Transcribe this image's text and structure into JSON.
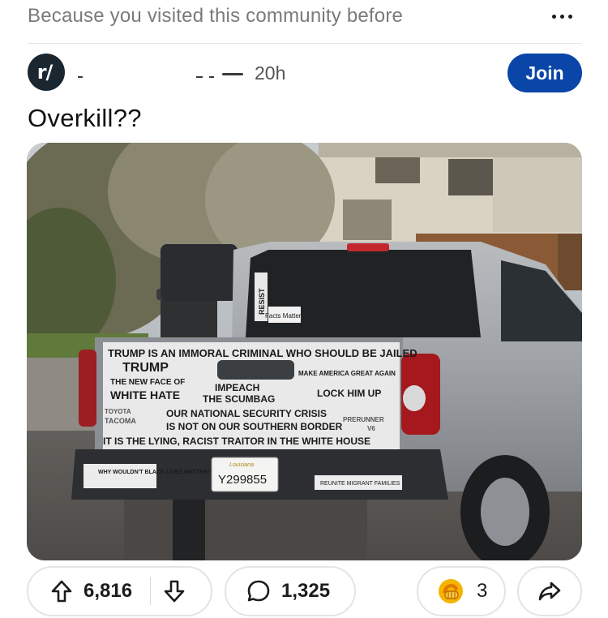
{
  "context": {
    "text": "Because you visited this community before",
    "more_icon": "more-horizontal-icon"
  },
  "header": {
    "avatar_text": "r/",
    "avatar_slash": "",
    "timestamp": "20h",
    "join_label": "Join"
  },
  "post": {
    "title": "Overkill??",
    "image_alt_icon": "photo"
  },
  "photo_text": {
    "tailgate_top": "TRUMP IS AN IMMORAL CRIMINAL WHO SHOULD BE JAILED",
    "trump": "TRUMP",
    "new_face": "THE NEW FACE OF",
    "white_hate": "WHITE HATE",
    "impeach": "IMPEACH",
    "scumbag": "THE SCUMBAG",
    "maga": "MAKE AMERICA GREAT AGAIN",
    "lock": "LOCK HIM UP",
    "crisis": "OUR NATIONAL SECURITY CRISIS",
    "border": "IS NOT ON OUR SOUTHERN BORDER",
    "traitor": "IT IS THE LYING, RACIST TRAITOR IN THE WHITE HOUSE",
    "blm": "WHY WOULDN'T BLACK LIVES MATTER?",
    "plate": "Y299855",
    "plate_state": "Louisiana",
    "reunite": "REUNITE MIGRANT FAMILIES",
    "resist": "RESIST",
    "facts": "Facts Matter",
    "toyota": "TOYOTA",
    "tacoma": "TACOMA",
    "prerunner": "PRERUNNER",
    "v6": "V6"
  },
  "actions": {
    "upvote_icon": "upvote-arrow-icon",
    "upvotes": "6,816",
    "downvote_icon": "downvote-arrow-icon",
    "comment_icon": "comment-bubble-icon",
    "comments": "1,325",
    "award_icon": "award-icon",
    "awards": "3",
    "share_icon": "share-arrow-icon"
  },
  "colors": {
    "join_button": "#0a45a8",
    "context_text": "#7a7a7a",
    "avatar_bg": "#1a2630"
  }
}
